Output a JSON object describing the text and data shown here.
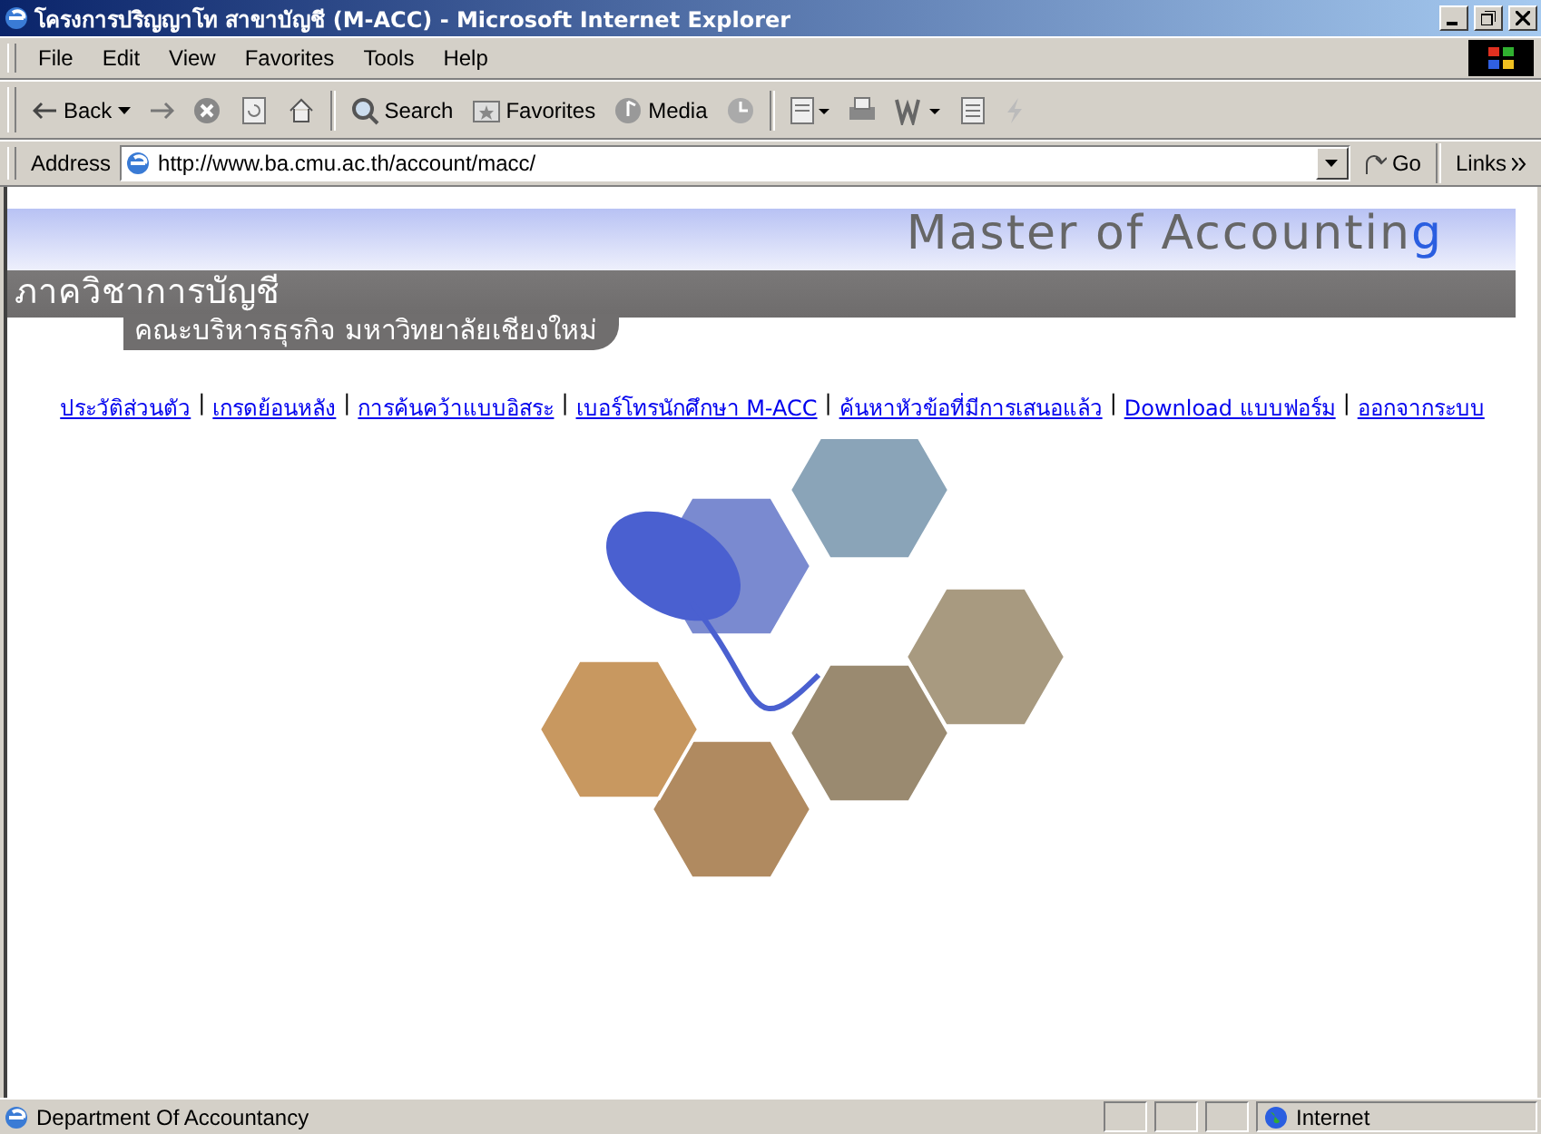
{
  "window": {
    "title": "โครงการปริญญาโท สาขาบัญชี (M-ACC) - Microsoft Internet Explorer"
  },
  "menu": [
    "File",
    "Edit",
    "View",
    "Favorites",
    "Tools",
    "Help"
  ],
  "toolbar": {
    "back": "Back",
    "search": "Search",
    "favorites": "Favorites",
    "media": "Media"
  },
  "address_bar": {
    "label": "Address",
    "url": "http://www.ba.cmu.ac.th/account/macc/",
    "go": "Go",
    "links": "Links"
  },
  "banner": {
    "title": [
      "Master of Accountin",
      "g"
    ],
    "department": "ภาควิชาการบัญชี",
    "faculty": "คณะบริหารธุรกิจ มหาวิทยาลัยเชียงใหม่"
  },
  "nav_separator": "|",
  "nav_links": [
    "ประวัติส่วนตัว",
    "เกรดย้อนหลัง",
    "การค้นคว้าแบบอิสระ",
    "เบอร์โทรนักศึกษา M-ACC",
    "ค้นหาหัวข้อที่มีการเสนอแล้ว",
    "Download แบบฟอร์ม",
    "ออกจากระบบ"
  ],
  "status_bar": {
    "text": "Department Of Accountancy",
    "zone": "Internet"
  }
}
